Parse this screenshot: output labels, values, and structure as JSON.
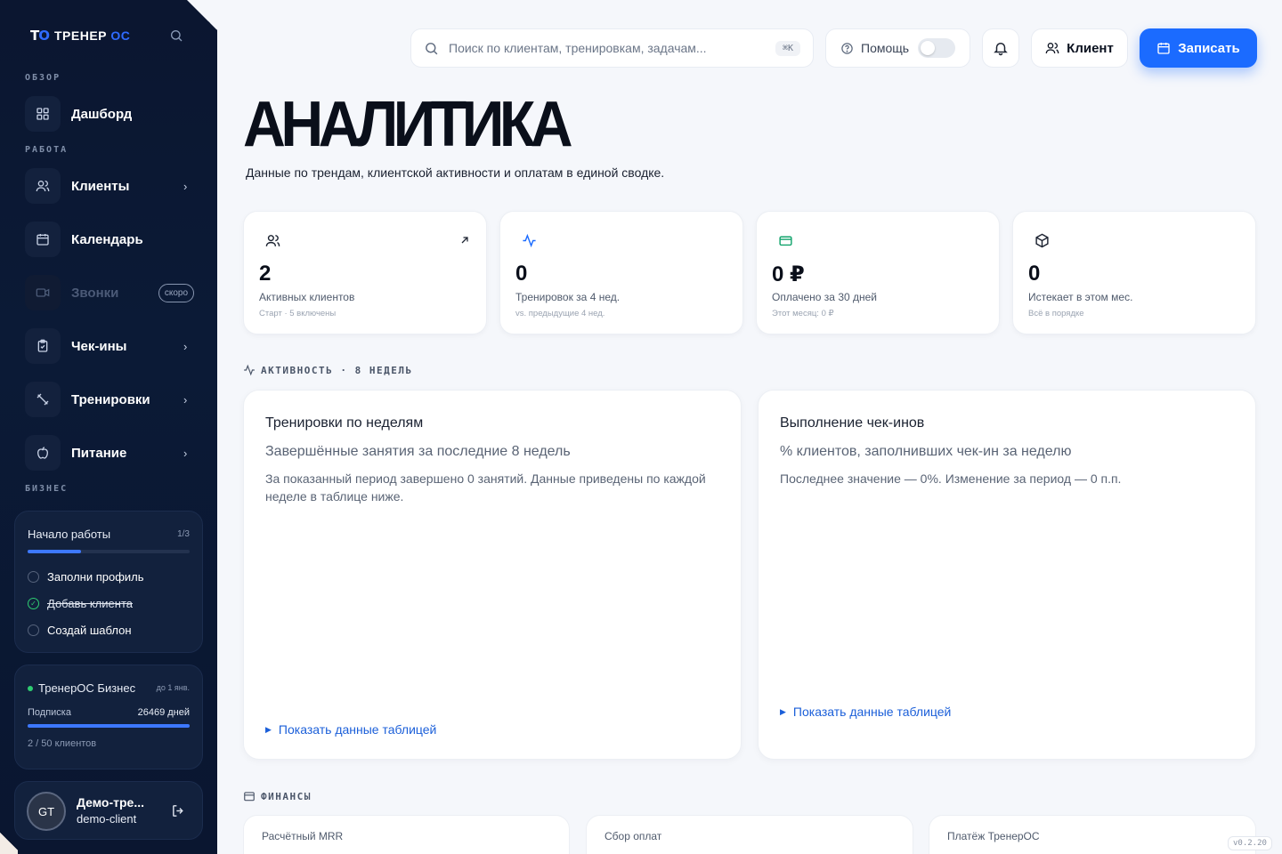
{
  "sidebar": {
    "logo_mark": "TO",
    "logo_text_a": "ТРЕНЕР ",
    "logo_text_b": "ОС",
    "sections": {
      "overview": "ОБЗОР",
      "work": "РАБОТА",
      "business": "БИЗНЕС"
    },
    "items": [
      {
        "label": "Дашборд",
        "icon": "dashboard-icon"
      },
      {
        "label": "Клиенты",
        "icon": "users-icon"
      },
      {
        "label": "Календарь",
        "icon": "calendar-icon"
      },
      {
        "label": "Звонки",
        "icon": "video-icon",
        "badge": "скоро"
      },
      {
        "label": "Чек-ины",
        "icon": "clipboard-check-icon"
      },
      {
        "label": "Тренировки",
        "icon": "dumbbell-icon"
      },
      {
        "label": "Питание",
        "icon": "apple-icon"
      }
    ],
    "onboarding": {
      "title": "Начало работы",
      "count": "1/3",
      "progress": 0.33,
      "tasks": [
        {
          "label": "Заполни профиль",
          "done": false
        },
        {
          "label": "Добавь клиента",
          "done": true
        },
        {
          "label": "Создай шаблон",
          "done": false
        }
      ]
    },
    "plan": {
      "title": "ТренерОС Бизнес",
      "until": "до 1 янв.",
      "subscription_label": "Подписка",
      "subscription_value": "26469 дней",
      "progress": 1.0,
      "clients": "2 / 50 клиентов"
    },
    "user": {
      "initials": "GT",
      "name": "Демо-тре...",
      "login": "demo-client"
    }
  },
  "topbar": {
    "search_placeholder": "Поиск по клиентам, тренировкам, задачам...",
    "search_shortcut": "⌘K",
    "help_label": "Помощь",
    "client_label": "Клиент",
    "primary_label": "Записать"
  },
  "page": {
    "title": "АНАЛИТИКА",
    "subtitle": "Данные по трендам, клиентской активности и оплатам в единой сводке."
  },
  "kpis": [
    {
      "value": "2",
      "label": "Активных клиентов",
      "sub": "Старт · 5 включены",
      "icon": "users-icon",
      "color": "#1c2331"
    },
    {
      "value": "0",
      "label": "Тренировок за 4 нед.",
      "sub": "vs. предыдущие 4 нед.",
      "icon": "activity-icon",
      "color": "#1b6bff"
    },
    {
      "value": "0 ₽",
      "label": "Оплачено за 30 дней",
      "sub": "Этот месяц: 0 ₽",
      "icon": "credit-card-icon",
      "color": "#10a36b"
    },
    {
      "value": "0",
      "label": "Истекает в этом мес.",
      "sub": "Всё в порядке",
      "icon": "package-icon",
      "color": "#1c2331"
    }
  ],
  "activity": {
    "heading": "АКТИВНОСТЬ · 8 НЕДЕЛЬ",
    "cards": [
      {
        "title": "Тренировки по неделям",
        "subtitle": "Завершённые занятия за последние 8 недель",
        "description": "За показанный период завершено 0 занятий. Данные приведены по каждой неделе в таблице ниже.",
        "toggle": "Показать данные таблицей"
      },
      {
        "title": "Выполнение чек-инов",
        "subtitle": "% клиентов, заполнивших чек-ин за неделю",
        "description": "Последнее значение — 0%. Изменение за период — 0 п.п.",
        "toggle": "Показать данные таблицей"
      }
    ]
  },
  "finance": {
    "heading": "ФИНАНСЫ",
    "cards": [
      {
        "label": "Расчётный MRR"
      },
      {
        "label": "Сбор оплат"
      },
      {
        "label": "Платёж ТренерОС"
      }
    ]
  },
  "version": "v0.2.20"
}
